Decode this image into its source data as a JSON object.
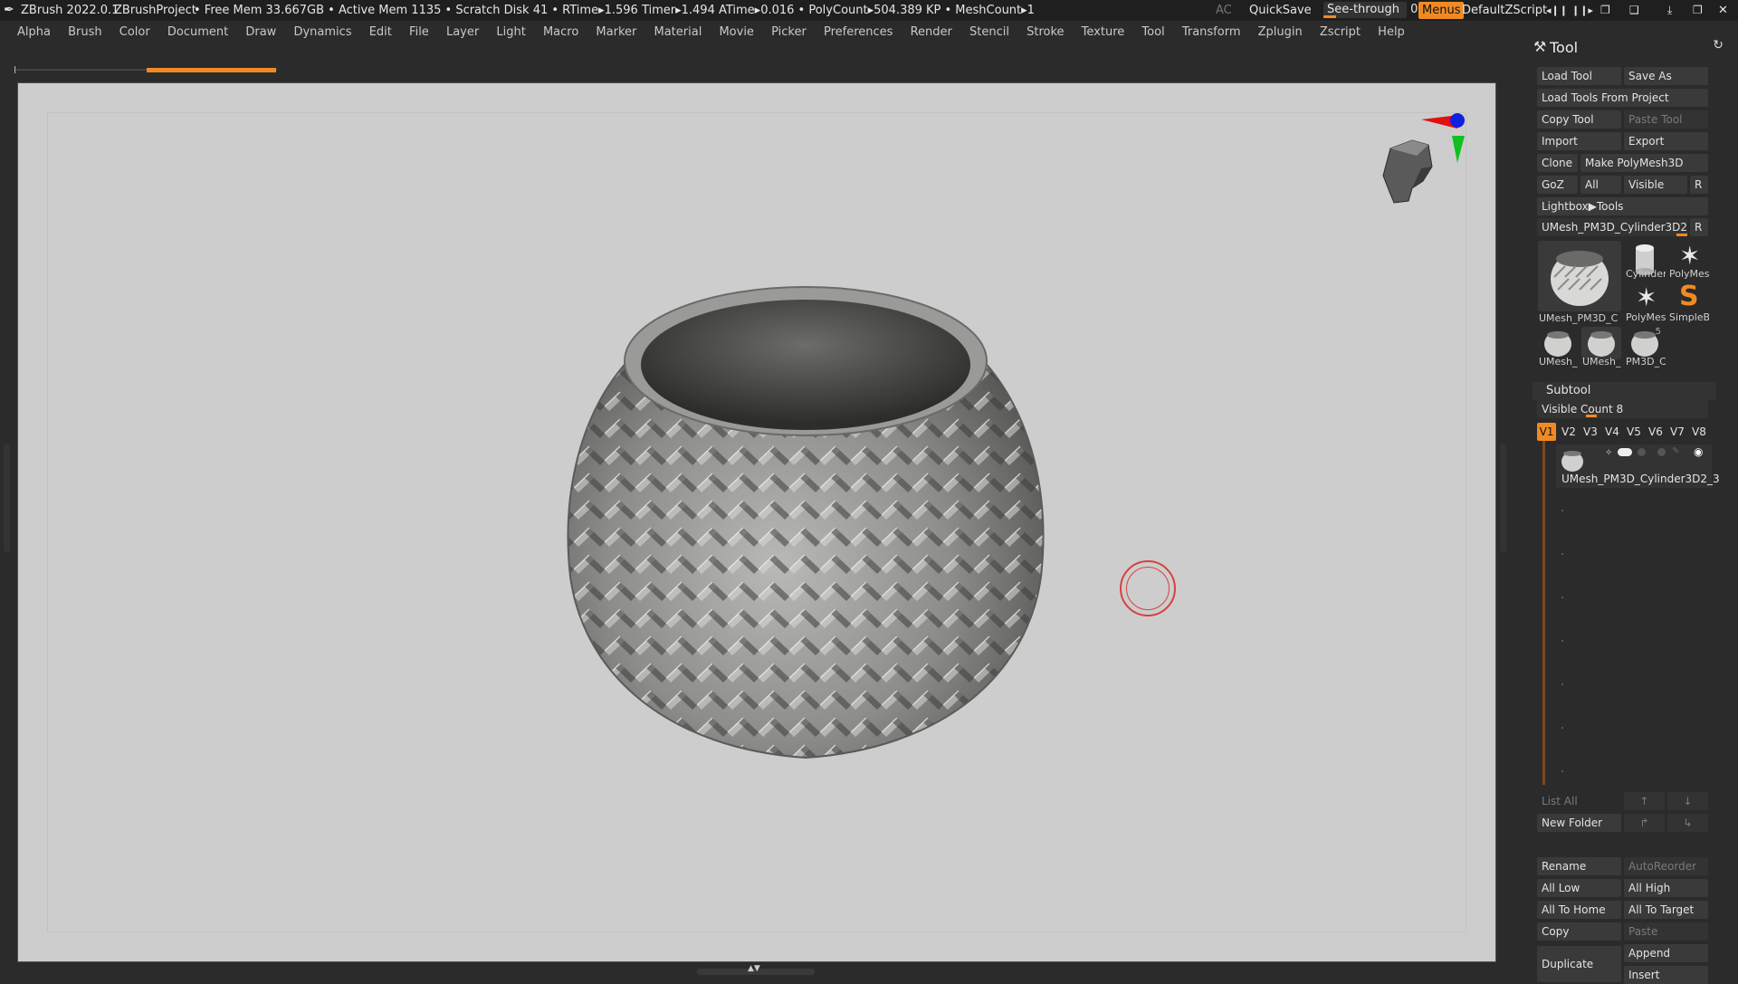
{
  "titlebar": {
    "app": "ZBrush 2022.0.1",
    "project": "ZBrushProject",
    "stats": "• Free Mem 33.667GB • Active Mem 1135 • Scratch Disk 41 •  RTime▸1.596 Timer▸1.494 ATime▸0.016 • PolyCount▸504.389 KP  • MeshCount▸1",
    "ac": "AC",
    "quicksave": "QuickSave",
    "seethrough_label": "See-through",
    "seethrough_value": "0",
    "menus": "Menus",
    "zscript": "DefaultZScript"
  },
  "menubar": {
    "items": [
      "Alpha",
      "Brush",
      "Color",
      "Document",
      "Draw",
      "Dynamics",
      "Edit",
      "File",
      "Layer",
      "Light",
      "Macro",
      "Marker",
      "Material",
      "Movie",
      "Picker",
      "Preferences",
      "Render",
      "Stencil",
      "Stroke",
      "Texture",
      "Tool",
      "Transform",
      "Zplugin",
      "Zscript",
      "Help"
    ]
  },
  "progress": {
    "value_fraction": 0.5
  },
  "tool_palette": {
    "title": "Tool",
    "load_tool": "Load Tool",
    "save_as": "Save As",
    "load_from_project": "Load Tools From Project",
    "copy_tool": "Copy Tool",
    "paste_tool": "Paste Tool",
    "import": "Import",
    "export": "Export",
    "clone": "Clone",
    "make_polymesh": "Make PolyMesh3D",
    "goz": "GoZ",
    "all": "All",
    "visible": "Visible",
    "r": "R",
    "lightbox_tools": "Lightbox▶Tools",
    "current_tool": "UMesh_PM3D_Cylinder3D2_3",
    "current_tool_r": "R",
    "thumbs": [
      {
        "label": "UMesh_PM3D_C"
      },
      {
        "label": "Cylinder"
      },
      {
        "label": "PolyMes"
      },
      {
        "label": "PolyMes"
      },
      {
        "label": "SimpleB"
      },
      {
        "label": "UMesh_"
      },
      {
        "label": "UMesh_"
      },
      {
        "label": "PM3D_C"
      }
    ],
    "badge_5": "5"
  },
  "subtool": {
    "title": "Subtool",
    "visible_count": "Visible Count 8",
    "versions": [
      "V1",
      "V2",
      "V3",
      "V4",
      "V5",
      "V6",
      "V7",
      "V8"
    ],
    "item_name": "UMesh_PM3D_Cylinder3D2_3",
    "list_all": "List All",
    "new_folder": "New Folder",
    "rename": "Rename",
    "auto_reorder": "AutoReorder",
    "all_low": "All Low",
    "all_high": "All High",
    "all_to_home": "All To Home",
    "all_to_target": "All To Target",
    "copy": "Copy",
    "paste": "Paste",
    "duplicate": "Duplicate",
    "append": "Append",
    "insert": "Insert"
  },
  "colors": {
    "accent": "#f08a24",
    "canvas": "#cdcdcd",
    "ui_bg": "#2b2b2b",
    "cursor_ring": "#d94040"
  }
}
